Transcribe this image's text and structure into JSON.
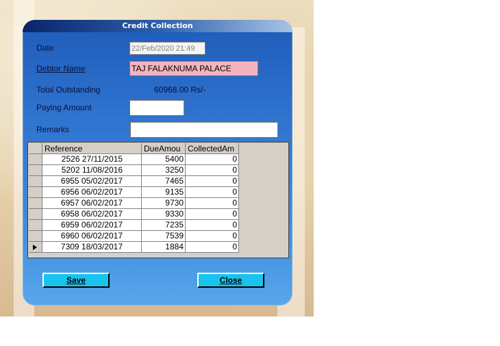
{
  "window": {
    "title": "Credit Collection"
  },
  "form": {
    "date_label": "Date",
    "date_value": "22/Feb/2020 21:49",
    "debtor_label": "Debtor Name",
    "debtor_value": "TAJ FALAKNUMA PALACE",
    "outstanding_label": "Total Outstanding",
    "outstanding_value": "60968.00 Rs/-",
    "paying_label": "Paying Amount",
    "paying_value": "",
    "remarks_label": "Remarks",
    "remarks_value": ""
  },
  "grid": {
    "columns": [
      "Reference",
      "DueAmou",
      "CollectedAm"
    ],
    "rows": [
      {
        "ref": "2526 27/11/2015",
        "due": "5400",
        "collected": "0"
      },
      {
        "ref": "5202 11/08/2016",
        "due": "3250",
        "collected": "0"
      },
      {
        "ref": "6955 05/02/2017",
        "due": "7465",
        "collected": "0"
      },
      {
        "ref": "6956 06/02/2017",
        "due": "9135",
        "collected": "0"
      },
      {
        "ref": "6957 06/02/2017",
        "due": "9730",
        "collected": "0"
      },
      {
        "ref": "6958 06/02/2017",
        "due": "9330",
        "collected": "0"
      },
      {
        "ref": "6959 06/02/2017",
        "due": "7235",
        "collected": "0"
      },
      {
        "ref": "6960 06/02/2017",
        "due": "7539",
        "collected": "0"
      },
      {
        "ref": "7309 18/03/2017",
        "due": "1884",
        "collected": "0"
      }
    ],
    "current_row_index": 8
  },
  "buttons": {
    "save_label": "Save",
    "close_label": "Close"
  },
  "colors": {
    "button": "#19c3ef",
    "debtor_field": "#f5b4bd",
    "dialog": "#2f74cf"
  }
}
